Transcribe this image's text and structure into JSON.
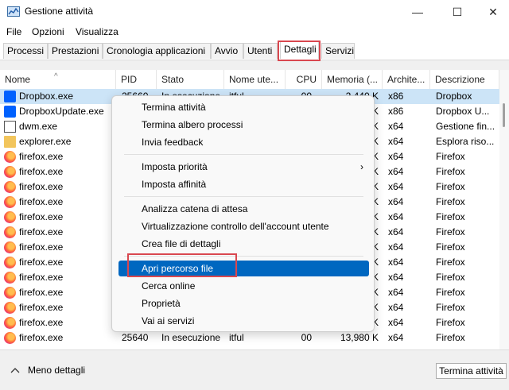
{
  "window": {
    "title": "Gestione attività",
    "minimize": "—",
    "maximize": "☐",
    "close": "✕"
  },
  "menu": [
    "File",
    "Opzioni",
    "Visualizza"
  ],
  "tabs": [
    "Processi",
    "Prestazioni",
    "Cronologia applicazioni",
    "Avvio",
    "Utenti",
    "Dettagli",
    "Servizi"
  ],
  "active_tab": "Dettagli",
  "columns": [
    "Nome",
    "PID",
    "Stato",
    "Nome ute...",
    "CPU",
    "Memoria (...",
    "Archite...",
    "Descrizione"
  ],
  "rows": [
    {
      "icon": "dropbox-icon",
      "name": "Dropbox.exe",
      "pid": "25660",
      "state": "In esecuzione",
      "user": "itful",
      "cpu": "00",
      "mem": "2,440 K",
      "arch": "x86",
      "desc": "Dropbox",
      "selected": true
    },
    {
      "icon": "dropbox-icon",
      "name": "DropboxUpdate.exe",
      "pid": "",
      "state": "",
      "user": "",
      "cpu": "",
      "mem": "K",
      "arch": "x86",
      "desc": "Dropbox U..."
    },
    {
      "icon": "dwm-icon",
      "name": "dwm.exe",
      "pid": "",
      "state": "",
      "user": "",
      "cpu": "",
      "mem": "K",
      "arch": "x64",
      "desc": "Gestione fin..."
    },
    {
      "icon": "folder-icon",
      "name": "explorer.exe",
      "pid": "",
      "state": "",
      "user": "",
      "cpu": "",
      "mem": "K",
      "arch": "x64",
      "desc": "Esplora riso..."
    },
    {
      "icon": "firefox-icon",
      "name": "firefox.exe",
      "pid": "",
      "state": "",
      "user": "",
      "cpu": "",
      "mem": "K",
      "arch": "x64",
      "desc": "Firefox"
    },
    {
      "icon": "firefox-icon",
      "name": "firefox.exe",
      "pid": "",
      "state": "",
      "user": "",
      "cpu": "",
      "mem": "K",
      "arch": "x64",
      "desc": "Firefox"
    },
    {
      "icon": "firefox-icon",
      "name": "firefox.exe",
      "pid": "",
      "state": "",
      "user": "",
      "cpu": "",
      "mem": "K",
      "arch": "x64",
      "desc": "Firefox"
    },
    {
      "icon": "firefox-icon",
      "name": "firefox.exe",
      "pid": "",
      "state": "",
      "user": "",
      "cpu": "",
      "mem": "K",
      "arch": "x64",
      "desc": "Firefox"
    },
    {
      "icon": "firefox-icon",
      "name": "firefox.exe",
      "pid": "",
      "state": "",
      "user": "",
      "cpu": "",
      "mem": "K",
      "arch": "x64",
      "desc": "Firefox"
    },
    {
      "icon": "firefox-icon",
      "name": "firefox.exe",
      "pid": "",
      "state": "",
      "user": "",
      "cpu": "",
      "mem": "K",
      "arch": "x64",
      "desc": "Firefox"
    },
    {
      "icon": "firefox-icon",
      "name": "firefox.exe",
      "pid": "",
      "state": "",
      "user": "",
      "cpu": "",
      "mem": "K",
      "arch": "x64",
      "desc": "Firefox"
    },
    {
      "icon": "firefox-icon",
      "name": "firefox.exe",
      "pid": "",
      "state": "",
      "user": "",
      "cpu": "",
      "mem": "K",
      "arch": "x64",
      "desc": "Firefox"
    },
    {
      "icon": "firefox-icon",
      "name": "firefox.exe",
      "pid": "",
      "state": "",
      "user": "",
      "cpu": "",
      "mem": "K",
      "arch": "x64",
      "desc": "Firefox"
    },
    {
      "icon": "firefox-icon",
      "name": "firefox.exe",
      "pid": "",
      "state": "",
      "user": "",
      "cpu": "",
      "mem": "K",
      "arch": "x64",
      "desc": "Firefox"
    },
    {
      "icon": "firefox-icon",
      "name": "firefox.exe",
      "pid": "",
      "state": "",
      "user": "",
      "cpu": "",
      "mem": "K",
      "arch": "x64",
      "desc": "Firefox"
    },
    {
      "icon": "firefox-icon",
      "name": "firefox.exe",
      "pid": "",
      "state": "",
      "user": "",
      "cpu": "",
      "mem": "K",
      "arch": "x64",
      "desc": "Firefox"
    },
    {
      "icon": "firefox-icon",
      "name": "firefox.exe",
      "pid": "25640",
      "state": "In esecuzione",
      "user": "itful",
      "cpu": "00",
      "mem": "13,980 K",
      "arch": "x64",
      "desc": "Firefox"
    }
  ],
  "context_menu": [
    {
      "label": "Termina attività"
    },
    {
      "label": "Termina albero processi"
    },
    {
      "label": "Invia feedback"
    },
    {
      "label": "Imposta priorità",
      "submenu_glyph": "›"
    },
    {
      "label": "Imposta affinità"
    },
    {
      "label": "Analizza catena di attesa"
    },
    {
      "label": "Virtualizzazione controllo dell'account utente"
    },
    {
      "label": "Crea file di dettagli"
    },
    {
      "label": "Apri percorso file",
      "active": true
    },
    {
      "label": "Cerca online"
    },
    {
      "label": "Proprietà"
    },
    {
      "label": "Vai ai servizi"
    }
  ],
  "footer": {
    "less_details": "Meno dettagli",
    "end_task": "Termina attività"
  },
  "colors": {
    "accent": "#0067c0",
    "selection": "#cce4f7",
    "highlight": "#d9474f"
  }
}
